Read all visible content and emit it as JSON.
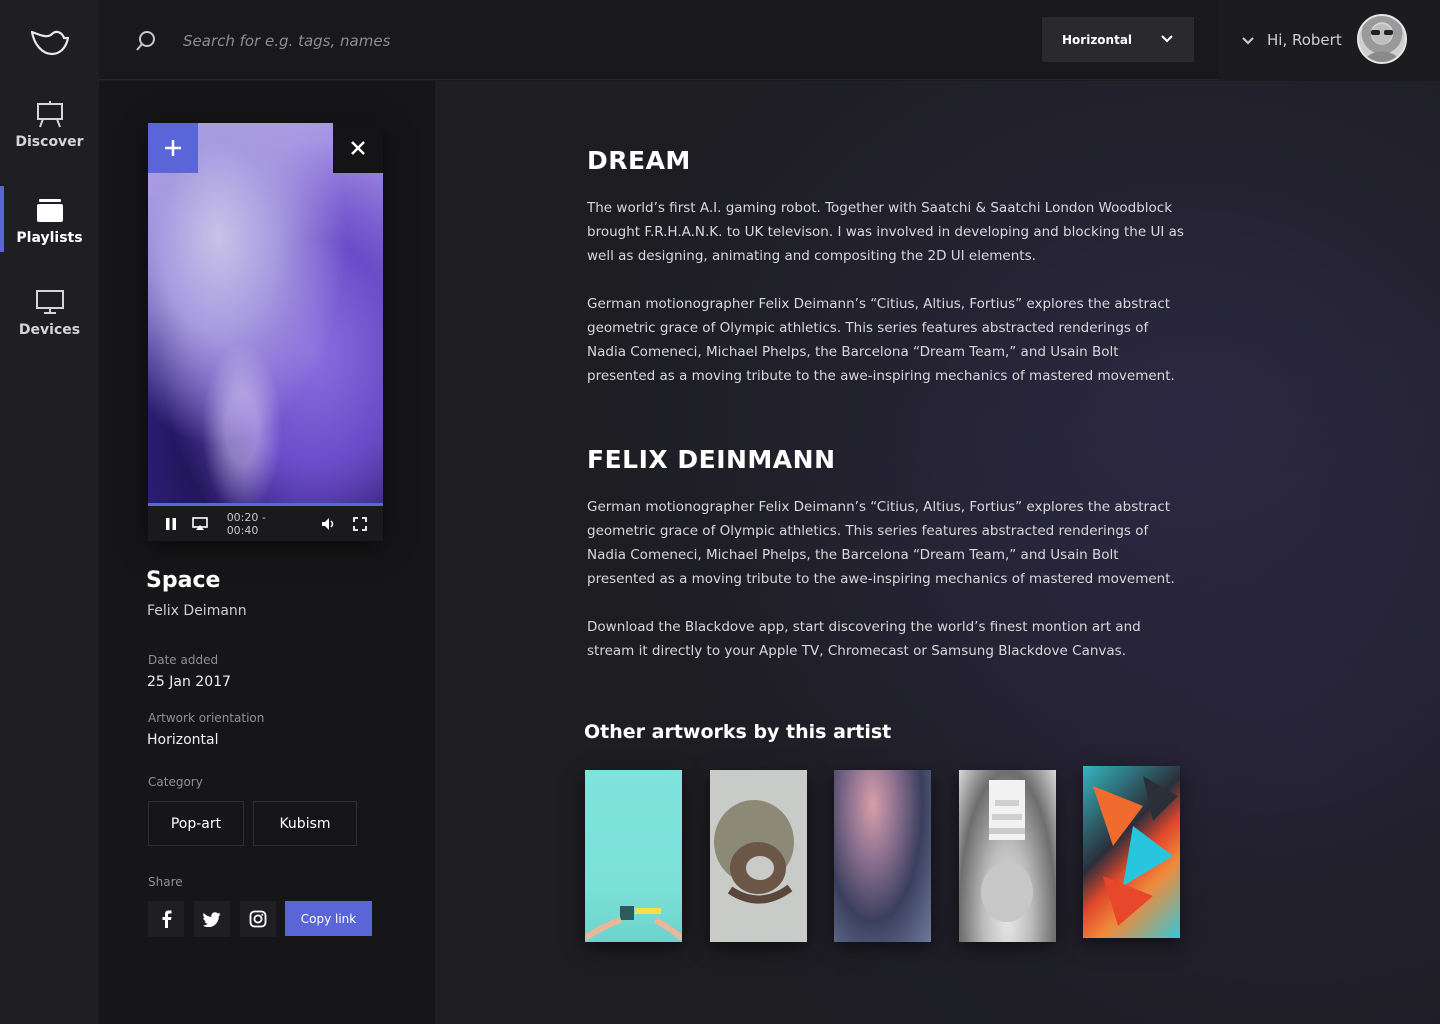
{
  "nav": {
    "items": [
      {
        "label": "Discover",
        "icon": "easel-icon"
      },
      {
        "label": "Playlists",
        "icon": "folder-icon"
      },
      {
        "label": "Devices",
        "icon": "monitor-icon"
      }
    ]
  },
  "search": {
    "placeholder": "Search for e.g. tags, names"
  },
  "orientation_select": {
    "value": "Horizontal"
  },
  "user": {
    "greeting": "Hi, Robert"
  },
  "player": {
    "time": "00:20 - 00:40",
    "progress": 1.0
  },
  "artwork": {
    "title": "Space",
    "artist": "Felix Deimann",
    "date_label": "Date added",
    "date_value": "25 Jan 2017",
    "orientation_label": "Artwork orientation",
    "orientation_value": "Horizontal",
    "category_label": "Category",
    "categories": [
      "Pop-art",
      "Kubism"
    ],
    "share_label": "Share",
    "copy_link": "Copy link"
  },
  "main": {
    "section1_title": "DREAM",
    "section1_p1": "The world’s first A.I. gaming robot. Together with Saatchi & Saatchi London Woodblock brought F.R.H.A.N.K. to UK televison. I was involved in developing and blocking the UI as well as designing, animating and compositing the 2D UI elements.",
    "section1_p2": "German motionographer Felix Deimann’s “Citius, Altius, Fortius” explores the abstract geometric grace of Olympic athletics. This series features abstracted renderings of Nadia Comeneci, Michael Phelps, the Barcelona “Dream Team,” and Usain Bolt presented as a moving tribute to the awe-inspiring mechanics of mastered movement.",
    "section2_title": "FELIX DEINMANN",
    "section2_p1": "German motionographer Felix Deimann’s “Citius, Altius, Fortius” explores the abstract geometric grace of Olympic athletics. This series features abstracted renderings of Nadia Comeneci, Michael Phelps, the Barcelona “Dream Team,” and Usain Bolt presented as a moving tribute to the awe-inspiring mechanics of mastered movement.",
    "section2_p2": "Download the Blackdove app, start discovering the world’s finest montion art and stream it directly to your Apple TV, Chromecast or Samsung Blackdove Canvas.",
    "other_title": "Other artworks by this artist"
  },
  "colors": {
    "accent": "#5a66d8",
    "background": "#1d1d22",
    "panel": "#161618"
  }
}
